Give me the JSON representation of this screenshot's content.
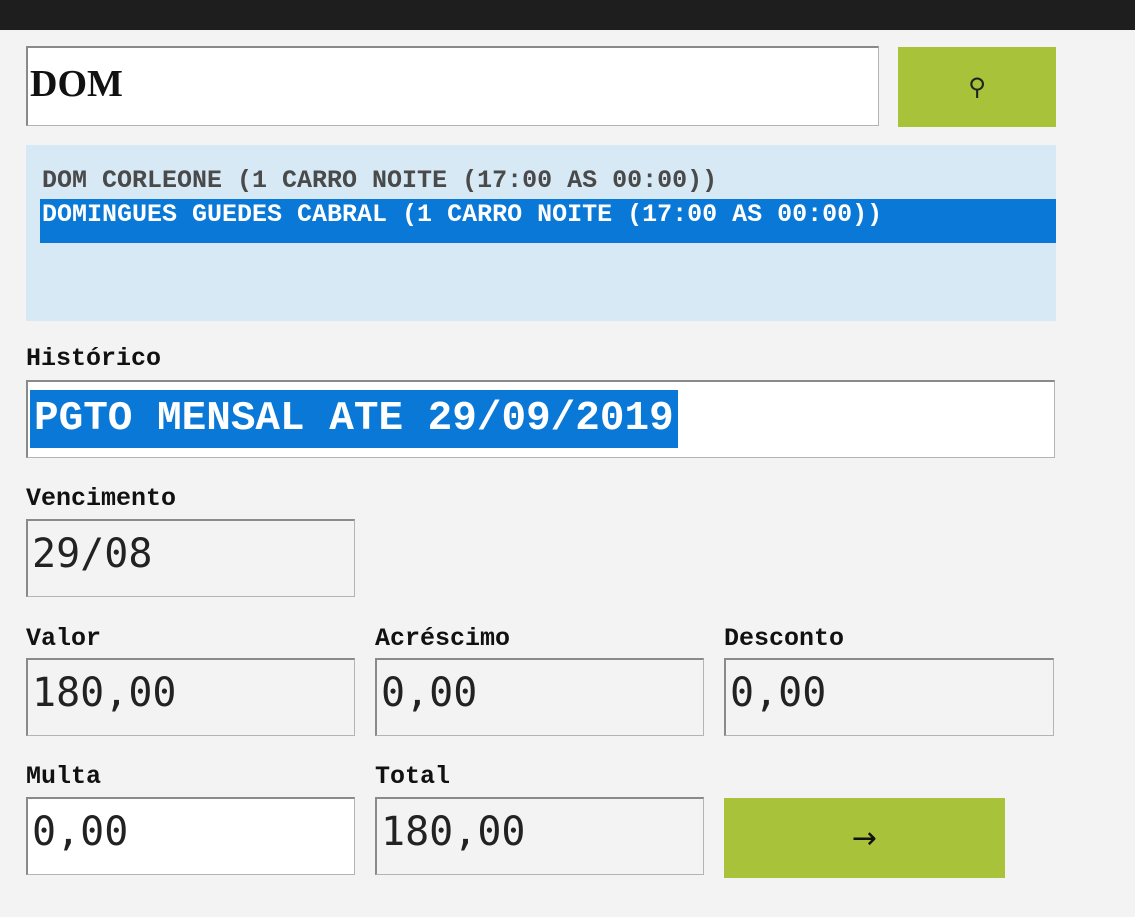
{
  "search": {
    "value": "DOM"
  },
  "search_button": {
    "icon": "key-icon",
    "glyph": "⚲"
  },
  "results": {
    "items": [
      "DOM CORLEONE (1 CARRO NOITE (17:00 AS 00:00))",
      "DOMINGUES GUEDES CABRAL (1 CARRO NOITE (17:00 AS 00:00))"
    ],
    "selected_index": 1
  },
  "historico": {
    "label": "Histórico",
    "value": "PGTO MENSAL ATE 29/09/2019"
  },
  "vencimento": {
    "label": "Vencimento",
    "value": "29/08"
  },
  "valor": {
    "label": "Valor",
    "value": "180,00"
  },
  "acrescimo": {
    "label": "Acréscimo",
    "value": "0,00"
  },
  "desconto": {
    "label": "Desconto",
    "value": "0,00"
  },
  "multa": {
    "label": "Multa",
    "value": "0,00"
  },
  "total": {
    "label": "Total",
    "value": "180,00"
  },
  "confirm_button": {
    "icon": "arrow-right-icon",
    "glyph": "→"
  },
  "colors": {
    "accent": "#a8c23a",
    "selection": "#0a78d7",
    "list_bg": "#d6e9f5",
    "titlebar": "#1e1e1e"
  }
}
